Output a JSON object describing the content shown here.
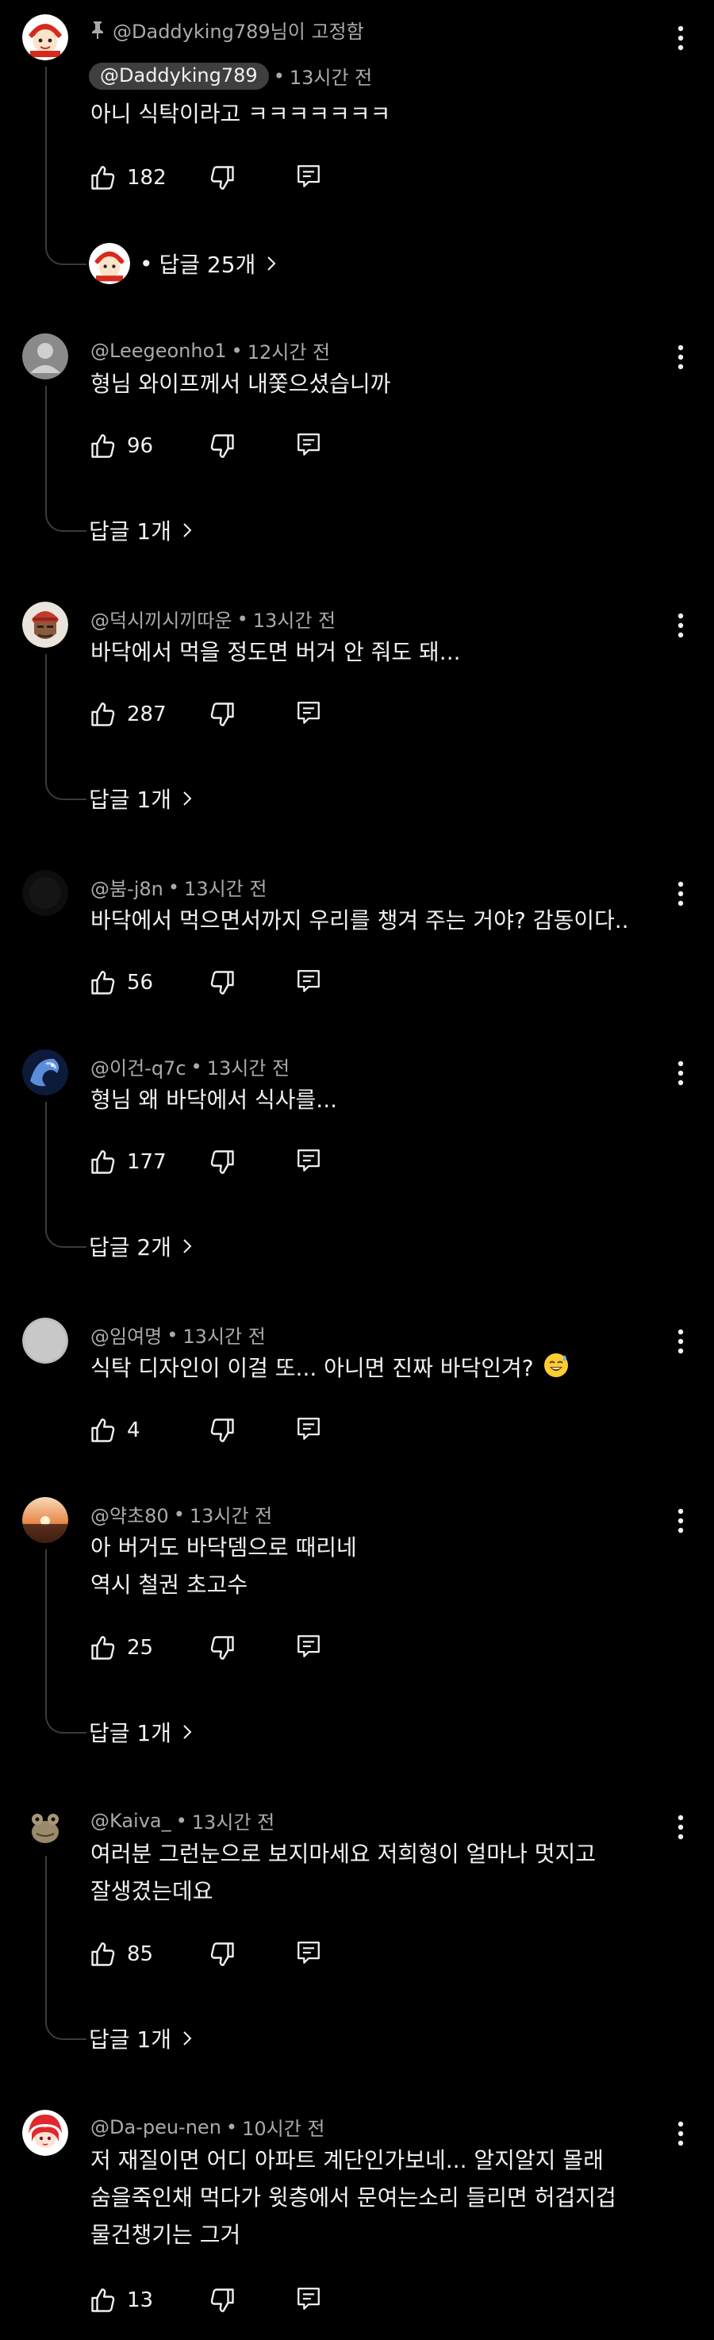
{
  "comments": [
    {
      "pinned_label": "@Daddyking789님이 고정함",
      "author": "@Daddyking789",
      "time": "13시간 전",
      "lines": [
        "아니 식탁이라고 ㅋㅋㅋㅋㅋㅋㅋ"
      ],
      "likes": "182",
      "replies_label": "답글 25개",
      "avatar": "red-white-cartoon-avatar"
    },
    {
      "author": "@Leegeonho1",
      "time": "12시간 전",
      "lines": [
        "형님 와이프께서 내쫓으셨습니까"
      ],
      "likes": "96",
      "replies_label": "답글 1개",
      "avatar": "default-gray-avatar"
    },
    {
      "author": "@덕시끼시끼따운",
      "time": "13시간 전",
      "lines": [
        "바닥에서 먹을 정도면 버거 안 줘도 돼..."
      ],
      "likes": "287",
      "replies_label": "답글 1개",
      "avatar": "red-helmet-avatar"
    },
    {
      "author": "@붐-j8n",
      "time": "13시간 전",
      "lines": [
        "바닥에서 먹으면서까지 우리를 챙겨 주는 거야? 감동이다.."
      ],
      "likes": "56",
      "avatar": "dark-avatar"
    },
    {
      "author": "@이건-q7c",
      "time": "13시간 전",
      "lines": [
        "형님 왜 바닥에서 식사를..."
      ],
      "likes": "177",
      "replies_label": "답글 2개",
      "avatar": "blue-dragon-avatar"
    },
    {
      "author": "@임여명",
      "time": "13시간 전",
      "lines": [
        "식탁 디자인이 이걸 또... 아니면 진짜 바닥인겨?"
      ],
      "emoji": "sweat-smile-emoji",
      "likes": "4",
      "avatar": "light-gray-avatar"
    },
    {
      "author": "@약초80",
      "time": "13시간 전",
      "lines": [
        "아 버거도 바닥뎀으로 때리네",
        "역시 철권 초고수"
      ],
      "likes": "25",
      "replies_label": "답글 1개",
      "avatar": "sunset-avatar"
    },
    {
      "author": "@Kaiva_",
      "time": "13시간 전",
      "lines": [
        "여러분 그런눈으로 보지마세요 저희형이 얼마나 멋지고",
        "잘생겼는데요"
      ],
      "likes": "85",
      "replies_label": "답글 1개",
      "avatar": "frog-meme-avatar"
    },
    {
      "author": "@Da-peu-nen",
      "time": "10시간 전",
      "lines": [
        "저 재질이면 어디 아파트 계단인가보네... 알지알지 몰래",
        "숨을죽인채 먹다가 윗층에서 문여는소리 들리면 허겁지겁",
        "물건챙기는 그거"
      ],
      "likes": "13",
      "avatar": "red-hair-anime-avatar"
    }
  ],
  "colors": {
    "background": "#000000",
    "text": "#f1f1f1",
    "meta": "#aaaaaa",
    "thread": "#3a3a3a",
    "chip": "#3f3f3f"
  }
}
